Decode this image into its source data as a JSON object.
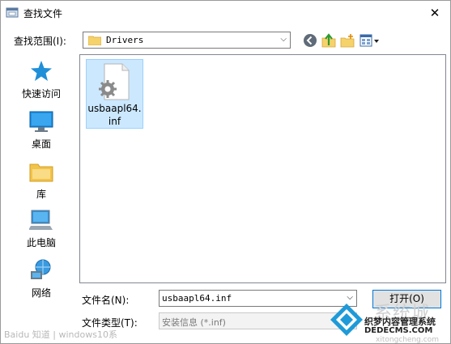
{
  "window": {
    "title": "查找文件"
  },
  "lookin": {
    "label": "查找范围(I):",
    "value": "Drivers"
  },
  "toolbar": {
    "back_icon": "back-arrow-icon",
    "up_icon": "up-folder-icon",
    "new_folder_icon": "new-folder-icon",
    "view_icon": "view-menu-icon"
  },
  "places": [
    {
      "label": "快速访问",
      "icon": "star-icon"
    },
    {
      "label": "桌面",
      "icon": "desktop-icon"
    },
    {
      "label": "库",
      "icon": "library-icon"
    },
    {
      "label": "此电脑",
      "icon": "computer-icon"
    },
    {
      "label": "网络",
      "icon": "network-icon"
    }
  ],
  "files": [
    {
      "name": "usbaapl64.inf",
      "selected": true,
      "icon": "settings-file-icon"
    }
  ],
  "filename": {
    "label": "文件名(N):",
    "value": "usbaapl64.inf"
  },
  "filetype": {
    "label": "文件类型(T):",
    "value": "安装信息 (*.inf)"
  },
  "buttons": {
    "open": "打开(O)"
  },
  "watermarks": {
    "left": "Baidu 知道 | windows10系",
    "brand_big": "系统城",
    "brand_cn": "织梦内容管理系统",
    "brand_en": "DEDECMS.COM",
    "brand_url": "xitongcheng.com"
  },
  "colors": {
    "selection_bg": "#cce8ff",
    "selection_border": "#99d1ff",
    "accent": "#0078d7"
  }
}
